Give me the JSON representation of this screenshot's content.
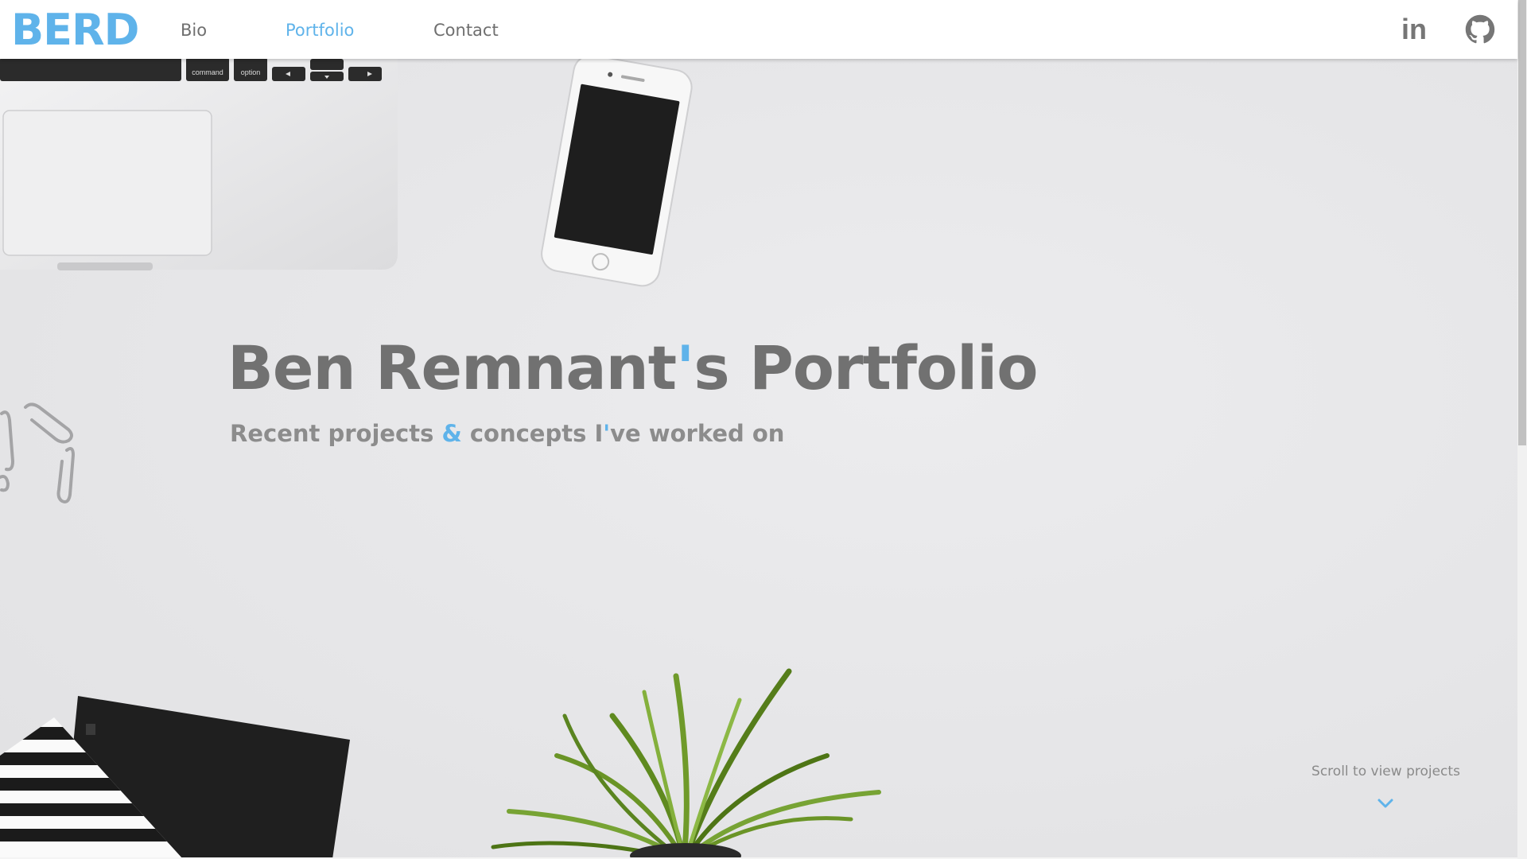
{
  "brand": {
    "logo_text": "BERD",
    "accent_color": "#5fb3ea"
  },
  "nav": {
    "items": [
      {
        "label": "Bio",
        "active": false
      },
      {
        "label": "Portfolio",
        "active": true
      },
      {
        "label": "Contact",
        "active": false
      }
    ],
    "social": [
      {
        "label": "in",
        "icon": "linkedin-icon"
      },
      {
        "icon": "github-icon"
      }
    ]
  },
  "hero": {
    "title_part1": "Ben Remnant",
    "title_apostrophe": "'",
    "title_part2": "s Portfolio",
    "subtitle_part1": "Recent projects ",
    "subtitle_amp": "&",
    "subtitle_part2": " concepts I",
    "subtitle_apostrophe": "'",
    "subtitle_part3": "ve worked on",
    "laptop_keys": [
      "command",
      "option"
    ],
    "scroll_hint": "Scroll to view projects",
    "scroll_icon": "chevron-down-icon"
  }
}
